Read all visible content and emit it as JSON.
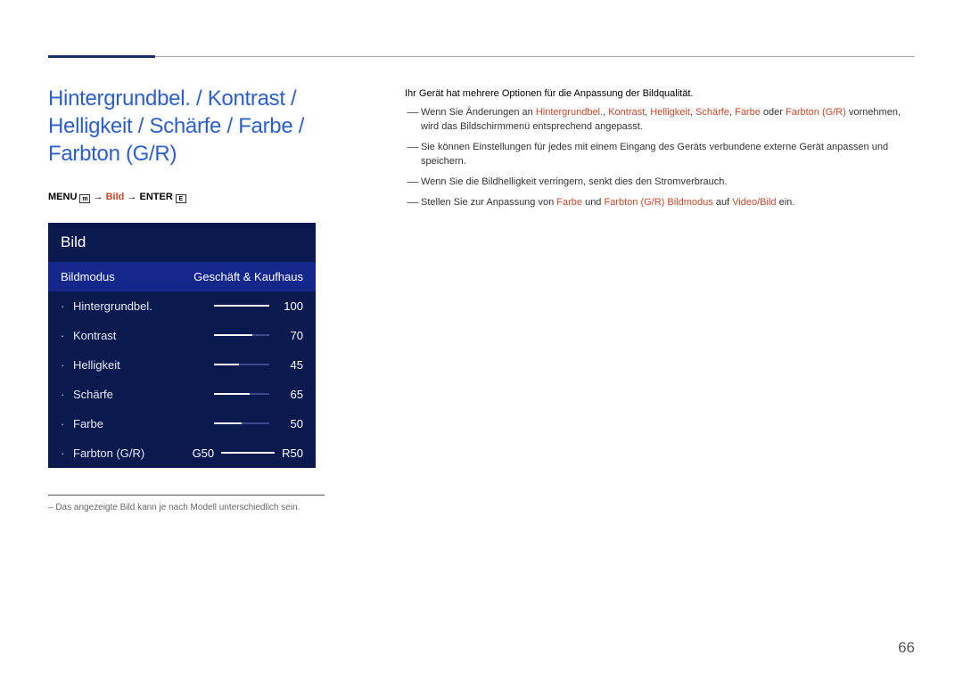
{
  "heading": "Hintergrundbel. / Kontrast / Helligkeit / Schärfe / Farbe / Farbton (G/R)",
  "menu_path": {
    "menu": "MENU",
    "arrow1": " → ",
    "bild": "Bild",
    "arrow2": " → ",
    "enter": "ENTER"
  },
  "panel": {
    "title": "Bild",
    "mode_label": "Bildmodus",
    "mode_value": "Geschäft & Kaufhaus",
    "rows": [
      {
        "label": "Hintergrundbel.",
        "value": "100",
        "fill": 100
      },
      {
        "label": "Kontrast",
        "value": "70",
        "fill": 70
      },
      {
        "label": "Helligkeit",
        "value": "45",
        "fill": 45
      },
      {
        "label": "Schärfe",
        "value": "65",
        "fill": 65
      },
      {
        "label": "Farbe",
        "value": "50",
        "fill": 50
      }
    ],
    "farbton": {
      "label": "Farbton (G/R)",
      "g": "G50",
      "r": "R50"
    }
  },
  "footnote": "– Das angezeigte Bild kann je nach Modell unterschiedlich sein.",
  "intro": "Ihr Gerät hat mehrere Optionen für die Anpassung der Bildqualität.",
  "notes": {
    "n1_a": "Wenn Sie Änderungen an ",
    "n1_b": "Hintergrundbel.",
    "n1_c": ", ",
    "n1_d": "Kontrast",
    "n1_e": ", ",
    "n1_f": "Helligkeit",
    "n1_g": ", ",
    "n1_h": "Schärfe",
    "n1_i": ", ",
    "n1_j": "Farbe",
    "n1_k": " oder ",
    "n1_l": "Farbton (G/R)",
    "n1_m": " vornehmen, wird das Bildschirmmenü entsprechend angepasst.",
    "n2": "Sie können Einstellungen für jedes mit einem Eingang des Geräts verbundene externe Gerät anpassen und speichern.",
    "n3": "Wenn Sie die Bildhelligkeit verringern, senkt dies den Stromverbrauch.",
    "n4_a": "Stellen Sie zur Anpassung von ",
    "n4_b": "Farbe",
    "n4_c": " und ",
    "n4_d": "Farbton (G/R)",
    "n4_e": " ",
    "n4_f": "Bildmodus",
    "n4_g": " auf ",
    "n4_h": "Video/Bild",
    "n4_i": " ein."
  },
  "page_number": "66"
}
